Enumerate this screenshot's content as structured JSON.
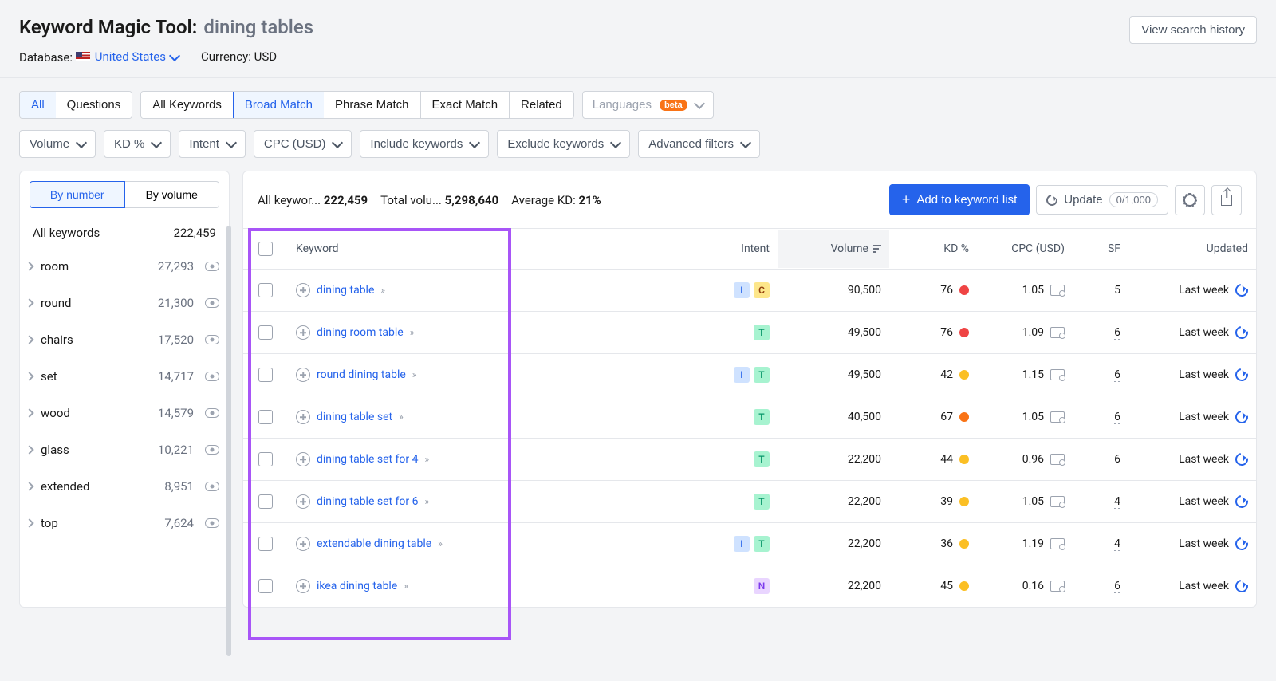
{
  "header": {
    "title": "Keyword Magic Tool:",
    "query": "dining tables",
    "btn_history": "View search history",
    "db_label": "Database:",
    "db_value": "United States",
    "currency_label": "Currency: USD"
  },
  "tabs": {
    "group1": [
      "All",
      "Questions"
    ],
    "group1_active": "All",
    "group2": [
      "All Keywords",
      "Broad Match",
      "Phrase Match",
      "Exact Match",
      "Related"
    ],
    "group2_active": "Broad Match",
    "languages": "Languages",
    "beta": "beta"
  },
  "filters": [
    "Volume",
    "KD %",
    "Intent",
    "CPC (USD)",
    "Include keywords",
    "Exclude keywords",
    "Advanced filters"
  ],
  "sidebar": {
    "tabs": [
      "By number",
      "By volume"
    ],
    "tabs_active": "By number",
    "all_label": "All keywords",
    "all_count": "222,459",
    "items": [
      {
        "label": "room",
        "count": "27,293"
      },
      {
        "label": "round",
        "count": "21,300"
      },
      {
        "label": "chairs",
        "count": "17,520"
      },
      {
        "label": "set",
        "count": "14,717"
      },
      {
        "label": "wood",
        "count": "14,579"
      },
      {
        "label": "glass",
        "count": "10,221"
      },
      {
        "label": "extended",
        "count": "8,951"
      },
      {
        "label": "top",
        "count": "7,624"
      }
    ]
  },
  "stats": {
    "all_kw_label": "All keywor...",
    "all_kw_val": "222,459",
    "total_vol_label": "Total volu...",
    "total_vol_val": "5,298,640",
    "avg_kd_label": "Average KD:",
    "avg_kd_val": "21%"
  },
  "actions": {
    "add": "Add to keyword list",
    "update": "Update",
    "update_count": "0/1,000"
  },
  "columns": {
    "kw": "Keyword",
    "intent": "Intent",
    "vol": "Volume",
    "kd": "KD %",
    "cpc": "CPC (USD)",
    "sf": "SF",
    "upd": "Updated"
  },
  "rows": [
    {
      "kw": "dining table",
      "intent": [
        "I",
        "C"
      ],
      "vol": "90,500",
      "kd": "76",
      "kd_color": "#ef4444",
      "cpc": "1.05",
      "sf": "5",
      "upd": "Last week"
    },
    {
      "kw": "dining room table",
      "intent": [
        "T"
      ],
      "vol": "49,500",
      "kd": "76",
      "kd_color": "#ef4444",
      "cpc": "1.09",
      "sf": "6",
      "upd": "Last week"
    },
    {
      "kw": "round dining table",
      "intent": [
        "I",
        "T"
      ],
      "vol": "49,500",
      "kd": "42",
      "kd_color": "#fbbf24",
      "cpc": "1.15",
      "sf": "6",
      "upd": "Last week"
    },
    {
      "kw": "dining table set",
      "intent": [
        "T"
      ],
      "vol": "40,500",
      "kd": "67",
      "kd_color": "#f97316",
      "cpc": "1.05",
      "sf": "6",
      "upd": "Last week"
    },
    {
      "kw": "dining table set for 4",
      "intent": [
        "T"
      ],
      "vol": "22,200",
      "kd": "44",
      "kd_color": "#fbbf24",
      "cpc": "0.96",
      "sf": "6",
      "upd": "Last week"
    },
    {
      "kw": "dining table set for 6",
      "intent": [
        "T"
      ],
      "vol": "22,200",
      "kd": "39",
      "kd_color": "#fbbf24",
      "cpc": "1.05",
      "sf": "4",
      "upd": "Last week"
    },
    {
      "kw": "extendable dining table",
      "intent": [
        "I",
        "T"
      ],
      "vol": "22,200",
      "kd": "36",
      "kd_color": "#fbbf24",
      "cpc": "1.19",
      "sf": "4",
      "upd": "Last week"
    },
    {
      "kw": "ikea dining table",
      "intent": [
        "N"
      ],
      "vol": "22,200",
      "kd": "45",
      "kd_color": "#fbbf24",
      "cpc": "0.16",
      "sf": "6",
      "upd": "Last week"
    }
  ]
}
